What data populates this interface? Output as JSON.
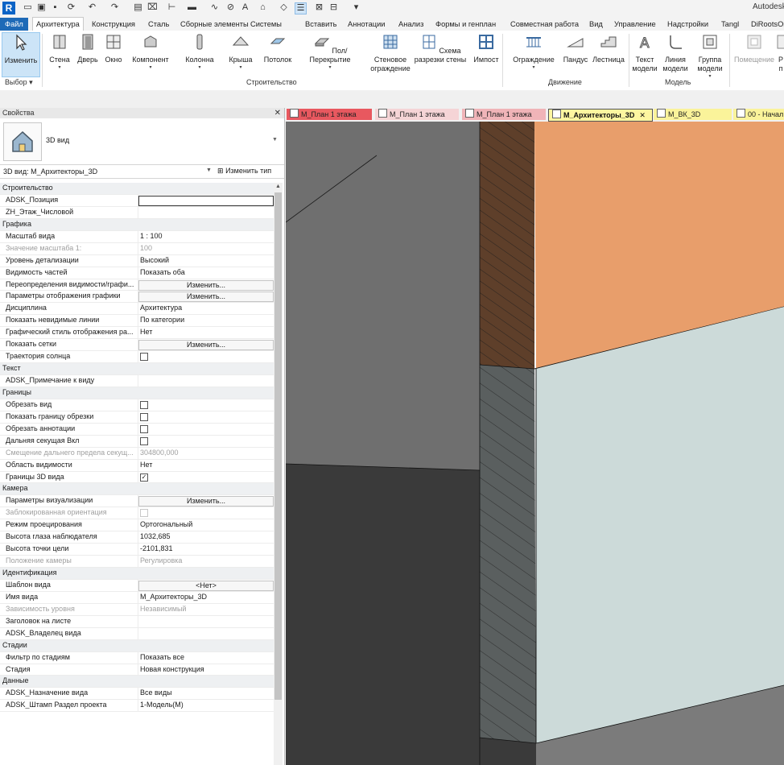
{
  "app": {
    "title_partial": "Autodesk"
  },
  "quick_access": {
    "icons": [
      "revit-logo-icon",
      "open-icon",
      "save-icon",
      "sync-icon",
      "undo-icon",
      "redo-icon",
      "print-icon",
      "measure-icon",
      "dimension-icon",
      "tag-icon",
      "text-icon",
      "3d-view-icon",
      "section-icon",
      "thin-lines-icon",
      "close-hidden-icon",
      "switch-windows-icon",
      "customize-icon"
    ]
  },
  "menu": {
    "file": "Файл",
    "tabs": [
      "Архитектура",
      "Конструкция",
      "Сталь",
      "Сборные элементы",
      "Системы",
      "Вставить",
      "Аннотации",
      "Анализ",
      "Формы и генплан",
      "Совместная работа",
      "Вид",
      "Управление",
      "Надстройки",
      "Tangl",
      "DiRootsOn"
    ],
    "active": "Архитектура"
  },
  "ribbon": {
    "select": {
      "label": "Изменить",
      "panel": "Выбор"
    },
    "build_buttons": [
      {
        "label": "Стена",
        "icon": "wall-icon",
        "dd": true
      },
      {
        "label": "Дверь",
        "icon": "door-icon",
        "dd": false
      },
      {
        "label": "Окно",
        "icon": "window-icon",
        "dd": false
      },
      {
        "label": "Компонент",
        "icon": "component-icon",
        "dd": true
      },
      {
        "label": "Колонна",
        "icon": "column-icon",
        "dd": true
      },
      {
        "label": "Крыша",
        "icon": "roof-icon",
        "dd": true
      },
      {
        "label": "Потолок",
        "icon": "ceiling-icon",
        "dd": false
      },
      {
        "label": "Пол/Перекрытие",
        "icon": "floor-icon",
        "dd": true
      },
      {
        "label": "Стеновое ограждение",
        "icon": "curtain-wall-icon",
        "dd": false
      },
      {
        "label": "Схема разрезки стены",
        "icon": "curtain-grid-icon",
        "dd": false
      },
      {
        "label": "Импост",
        "icon": "mullion-icon",
        "dd": false
      }
    ],
    "build_panel": "Строительство",
    "circulation_buttons": [
      {
        "label": "Ограждение",
        "icon": "railing-icon",
        "dd": true
      },
      {
        "label": "Пандус",
        "icon": "ramp-icon",
        "dd": false
      },
      {
        "label": "Лестница",
        "icon": "stair-icon",
        "dd": false
      }
    ],
    "circulation_panel": "Движение",
    "model_buttons": [
      {
        "label": "Текст модели",
        "icon": "model-text-icon",
        "dd": false
      },
      {
        "label": "Линия модели",
        "icon": "model-line-icon",
        "dd": false
      },
      {
        "label": "Группа модели",
        "icon": "model-group-icon",
        "dd": true
      }
    ],
    "model_panel": "Модель",
    "room_button": {
      "label": "Помещение",
      "icon": "room-icon"
    },
    "extra_partial": "Р п"
  },
  "properties": {
    "title": "Свойства",
    "type_name": "3D вид",
    "view_selector": "3D вид: М_Архитекторы_3D",
    "edit_type": "Изменить тип",
    "rows": [
      {
        "kind": "group",
        "k": "Строительство"
      },
      {
        "k": "ADSK_Позиция",
        "t": "box"
      },
      {
        "k": "ZH_Этаж_Числовой",
        "v": ""
      },
      {
        "kind": "group",
        "k": "Графика"
      },
      {
        "k": "Масштаб вида",
        "v": "1 : 100"
      },
      {
        "k": "Значение масштаба    1:",
        "v": "100",
        "dis": true
      },
      {
        "k": "Уровень детализации",
        "v": "Высокий"
      },
      {
        "k": "Видимость частей",
        "v": "Показать оба"
      },
      {
        "k": "Переопределения видимости/графи...",
        "t": "btn",
        "v": "Изменить..."
      },
      {
        "k": "Параметры отображения графики",
        "t": "btn",
        "v": "Изменить..."
      },
      {
        "k": "Дисциплина",
        "v": "Архитектура"
      },
      {
        "k": "Показать невидимые линии",
        "v": "По категории"
      },
      {
        "k": "Графический стиль отображения ра...",
        "v": "Нет"
      },
      {
        "k": "Показать сетки",
        "t": "btn",
        "v": "Изменить..."
      },
      {
        "k": "Траектория солнца",
        "t": "chk",
        "checked": false
      },
      {
        "kind": "group",
        "k": "Текст"
      },
      {
        "k": "ADSK_Примечание к виду",
        "v": ""
      },
      {
        "kind": "group",
        "k": "Границы"
      },
      {
        "k": "Обрезать вид",
        "t": "chk",
        "checked": false
      },
      {
        "k": "Показать границу обрезки",
        "t": "chk",
        "checked": false
      },
      {
        "k": "Обрезать аннотации",
        "t": "chk",
        "checked": false
      },
      {
        "k": "Дальняя секущая Вкл",
        "t": "chk",
        "checked": false
      },
      {
        "k": "Смещение дальнего предела секущ...",
        "v": "304800,000",
        "dis": true
      },
      {
        "k": "Область видимости",
        "v": "Нет"
      },
      {
        "k": "Границы 3D вида",
        "t": "chk",
        "checked": true
      },
      {
        "kind": "group",
        "k": "Камера"
      },
      {
        "k": "Параметры визуализации",
        "t": "btn",
        "v": "Изменить..."
      },
      {
        "k": "Заблокированная ориентация",
        "t": "chk",
        "checked": false,
        "dis": true
      },
      {
        "k": "Режим проецирования",
        "v": "Ортогональный"
      },
      {
        "k": "Высота глаза наблюдателя",
        "v": "1032,685"
      },
      {
        "k": "Высота точки цели",
        "v": "-2101,831"
      },
      {
        "k": "Положение камеры",
        "v": "Регулировка",
        "dis": true
      },
      {
        "kind": "group",
        "k": "Идентификация"
      },
      {
        "k": "Шаблон вида",
        "t": "btn",
        "v": "<Нет>"
      },
      {
        "k": "Имя вида",
        "v": "М_Архитекторы_3D"
      },
      {
        "k": "Зависимость уровня",
        "v": "Независимый",
        "dis": true
      },
      {
        "k": "Заголовок на листе",
        "v": ""
      },
      {
        "k": "ADSK_Владелец вида",
        "v": ""
      },
      {
        "kind": "group",
        "k": "Стадии"
      },
      {
        "k": "Фильтр по стадиям",
        "v": "Показать все"
      },
      {
        "k": "Стадия",
        "v": "Новая конструкция"
      },
      {
        "kind": "group",
        "k": "Данные"
      },
      {
        "k": "ADSK_Назначение вида",
        "v": "Все виды"
      },
      {
        "k": "ADSK_Штамп Раздел проекта",
        "v": "1-Модель(М)"
      }
    ]
  },
  "view_tabs": [
    {
      "label": "М_План 1 этажа",
      "color": "#e8585f",
      "text": "#222"
    },
    {
      "label": "М_План 1 этажа",
      "color": "#f5d4d6",
      "text": "#222"
    },
    {
      "label": "М_План 1 этажа",
      "color": "#f0b4b8",
      "text": "#222"
    },
    {
      "label": "М_Архитекторы_3D",
      "color": "#fdf6a0",
      "text": "#111",
      "active": true,
      "close": "✕"
    },
    {
      "label": "М_ВК_3D",
      "color": "#faf39a",
      "text": "#222"
    },
    {
      "label": "00 - Начал",
      "color": "#faf39a",
      "text": "#222"
    }
  ],
  "colors": {
    "orange_face": "#e89e6b",
    "brown_band": "#5e3f2a",
    "light_wall": "#ccdad9",
    "dark_slab": "#3a3a3a",
    "grey_top": "#6f6f6f",
    "concrete": "#5a5f5f"
  }
}
